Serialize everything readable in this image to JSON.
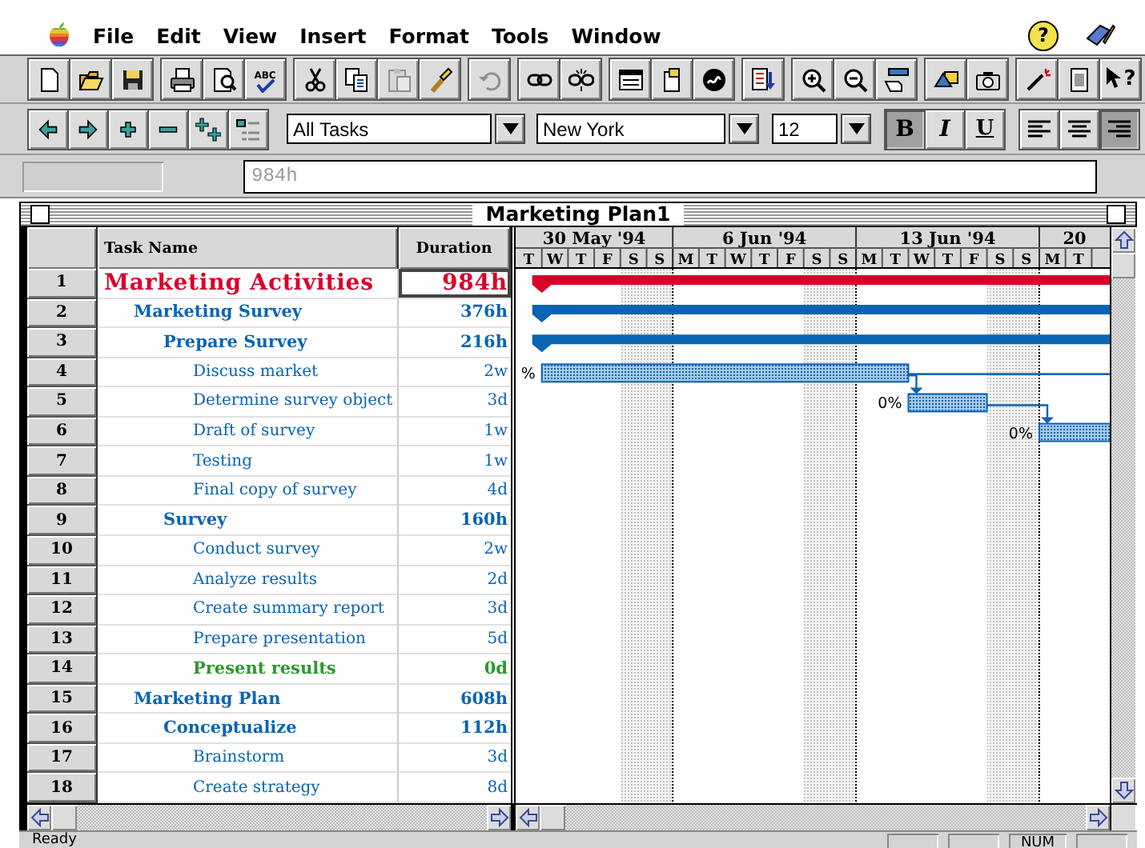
{
  "menu_bar": {
    "menus": [
      "File",
      "Edit",
      "View",
      "Insert",
      "Format",
      "Tools",
      "Window"
    ],
    "help": "?"
  },
  "standard_toolbar": {
    "groups": [
      [
        {
          "kind": "new",
          "disabled": false
        },
        {
          "kind": "open",
          "disabled": false
        },
        {
          "kind": "save",
          "disabled": false
        }
      ],
      [
        {
          "kind": "print",
          "disabled": false
        },
        {
          "kind": "preview",
          "disabled": false
        },
        {
          "kind": "spelling",
          "label": "ABC",
          "disabled": false
        }
      ],
      [
        {
          "kind": "cut",
          "disabled": false
        },
        {
          "kind": "copy",
          "disabled": false
        },
        {
          "kind": "paste",
          "disabled": true
        },
        {
          "kind": "painter",
          "disabled": false
        }
      ],
      [
        {
          "kind": "undo",
          "disabled": true
        }
      ],
      [
        {
          "kind": "link",
          "disabled": false
        },
        {
          "kind": "unlink",
          "disabled": false
        }
      ],
      [
        {
          "kind": "info",
          "disabled": false
        },
        {
          "kind": "notes",
          "disabled": false
        },
        {
          "kind": "swirl",
          "disabled": false
        }
      ],
      [
        {
          "kind": "docarrow",
          "disabled": false
        }
      ],
      [
        {
          "kind": "zoomin",
          "disabled": false
        },
        {
          "kind": "zoomout",
          "disabled": false
        },
        {
          "kind": "goto",
          "disabled": false
        }
      ],
      [
        {
          "kind": "shapes",
          "disabled": false
        },
        {
          "kind": "camera",
          "disabled": false
        }
      ],
      [
        {
          "kind": "wizard",
          "disabled": false
        },
        {
          "kind": "document",
          "disabled": false
        },
        {
          "kind": "help",
          "label": "?",
          "disabled": false
        }
      ]
    ]
  },
  "formatting_toolbar": {
    "outline_buttons": [
      {
        "kind": "outdent"
      },
      {
        "kind": "indent"
      },
      {
        "kind": "show"
      },
      {
        "kind": "hide"
      },
      {
        "kind": "showall"
      },
      {
        "kind": "outline"
      }
    ],
    "filter": "All Tasks",
    "font": "New York",
    "size": "12",
    "styles": [
      {
        "kind": "bold",
        "label": "B",
        "selected": true
      },
      {
        "kind": "italic",
        "label": "I",
        "selected": false
      },
      {
        "kind": "underline",
        "label": "U",
        "selected": false
      }
    ],
    "alignment": [
      {
        "kind": "left",
        "selected": false
      },
      {
        "kind": "center",
        "selected": false
      },
      {
        "kind": "right",
        "selected": true
      }
    ]
  },
  "entry_bar": {
    "value": "984h"
  },
  "window": {
    "title": "Marketing Plan1"
  },
  "table": {
    "columns": [
      "Task Name",
      "Duration"
    ],
    "rows": [
      {
        "id": "1",
        "name": "Marketing Activities",
        "duration": "984h",
        "kind": "project",
        "selected": true,
        "bar": {
          "color": "#d8002a"
        },
        "children": [
          {
            "id": "2",
            "name": "Marketing Survey",
            "duration": "376h",
            "kind": "summary",
            "selected": false,
            "bar": {
              "color": "#0a64b4"
            },
            "children": [
              {
                "id": "3",
                "name": "Prepare Survey",
                "duration": "216h",
                "kind": "summary",
                "selected": false,
                "bar": {
                  "color": "#0a64b4"
                },
                "children": [
                  {
                    "id": "4",
                    "name": "Discuss market",
                    "duration": "2w",
                    "kind": "task",
                    "selected": false,
                    "bar": {
                      "color": "#0a64b4",
                      "label": "%",
                      "link_next": true,
                      "line_onward": true
                    }
                  },
                  {
                    "id": "5",
                    "name": "Determine survey object",
                    "duration": "3d",
                    "kind": "task",
                    "selected": false,
                    "bar": {
                      "color": "#0a64b4",
                      "label": "0%",
                      "link_next": true,
                      "line_onward": false
                    }
                  },
                  {
                    "id": "6",
                    "name": "Draft of survey",
                    "duration": "1w",
                    "kind": "task",
                    "selected": false,
                    "bar": {
                      "color": "#0a64b4",
                      "label": "0%",
                      "link_next": false,
                      "line_onward": false
                    }
                  },
                  {
                    "id": "7",
                    "name": "Testing",
                    "duration": "1w",
                    "kind": "task",
                    "selected": false
                  },
                  {
                    "id": "8",
                    "name": "Final copy of survey",
                    "duration": "4d",
                    "kind": "task",
                    "selected": false
                  }
                ]
              },
              {
                "id": "9",
                "name": "Survey",
                "duration": "160h",
                "kind": "summary",
                "selected": false,
                "children": [
                  {
                    "id": "10",
                    "name": "Conduct survey",
                    "duration": "2w",
                    "kind": "task",
                    "selected": false
                  },
                  {
                    "id": "11",
                    "name": "Analyze results",
                    "duration": "2d",
                    "kind": "task",
                    "selected": false
                  },
                  {
                    "id": "12",
                    "name": "Create summary report",
                    "duration": "3d",
                    "kind": "task",
                    "selected": false
                  },
                  {
                    "id": "13",
                    "name": "Prepare presentation",
                    "duration": "5d",
                    "kind": "task",
                    "selected": false
                  },
                  {
                    "id": "14",
                    "name": "Present results",
                    "duration": "0d",
                    "kind": "milestone",
                    "selected": false
                  }
                ]
              }
            ]
          },
          {
            "id": "15",
            "name": "Marketing Plan",
            "duration": "608h",
            "kind": "summary",
            "selected": false,
            "children": [
              {
                "id": "16",
                "name": "Conceptualize",
                "duration": "112h",
                "kind": "summary",
                "selected": false,
                "children": [
                  {
                    "id": "17",
                    "name": "Brainstorm",
                    "duration": "3d",
                    "kind": "task",
                    "selected": false
                  },
                  {
                    "id": "18",
                    "name": "Create strategy",
                    "duration": "8d",
                    "kind": "task",
                    "selected": false
                  }
                ]
              }
            ]
          }
        ]
      }
    ]
  },
  "gantt": {
    "weeks": [
      {
        "label": "30 May '94",
        "days": [
          {
            "label": "T",
            "weekend": false
          },
          {
            "label": "W",
            "weekend": false
          },
          {
            "label": "T",
            "weekend": false
          },
          {
            "label": "F",
            "weekend": false
          },
          {
            "label": "S",
            "weekend": true
          },
          {
            "label": "S",
            "weekend": true
          }
        ]
      },
      {
        "label": "6 Jun '94",
        "days": [
          {
            "label": "M",
            "weekend": false
          },
          {
            "label": "T",
            "weekend": false
          },
          {
            "label": "W",
            "weekend": false
          },
          {
            "label": "T",
            "weekend": false
          },
          {
            "label": "F",
            "weekend": false
          },
          {
            "label": "S",
            "weekend": true
          },
          {
            "label": "S",
            "weekend": true
          }
        ]
      },
      {
        "label": "13 Jun '94",
        "days": [
          {
            "label": "M",
            "weekend": false
          },
          {
            "label": "T",
            "weekend": false
          },
          {
            "label": "W",
            "weekend": false
          },
          {
            "label": "T",
            "weekend": false
          },
          {
            "label": "F",
            "weekend": false
          },
          {
            "label": "S",
            "weekend": true
          },
          {
            "label": "S",
            "weekend": true
          }
        ]
      },
      {
        "label": "20",
        "days": [
          {
            "label": "M",
            "weekend": false
          },
          {
            "label": "T",
            "weekend": false
          }
        ]
      }
    ]
  },
  "status_bar": {
    "text": "Ready",
    "indicators": [
      {
        "label": "NUM"
      }
    ]
  }
}
